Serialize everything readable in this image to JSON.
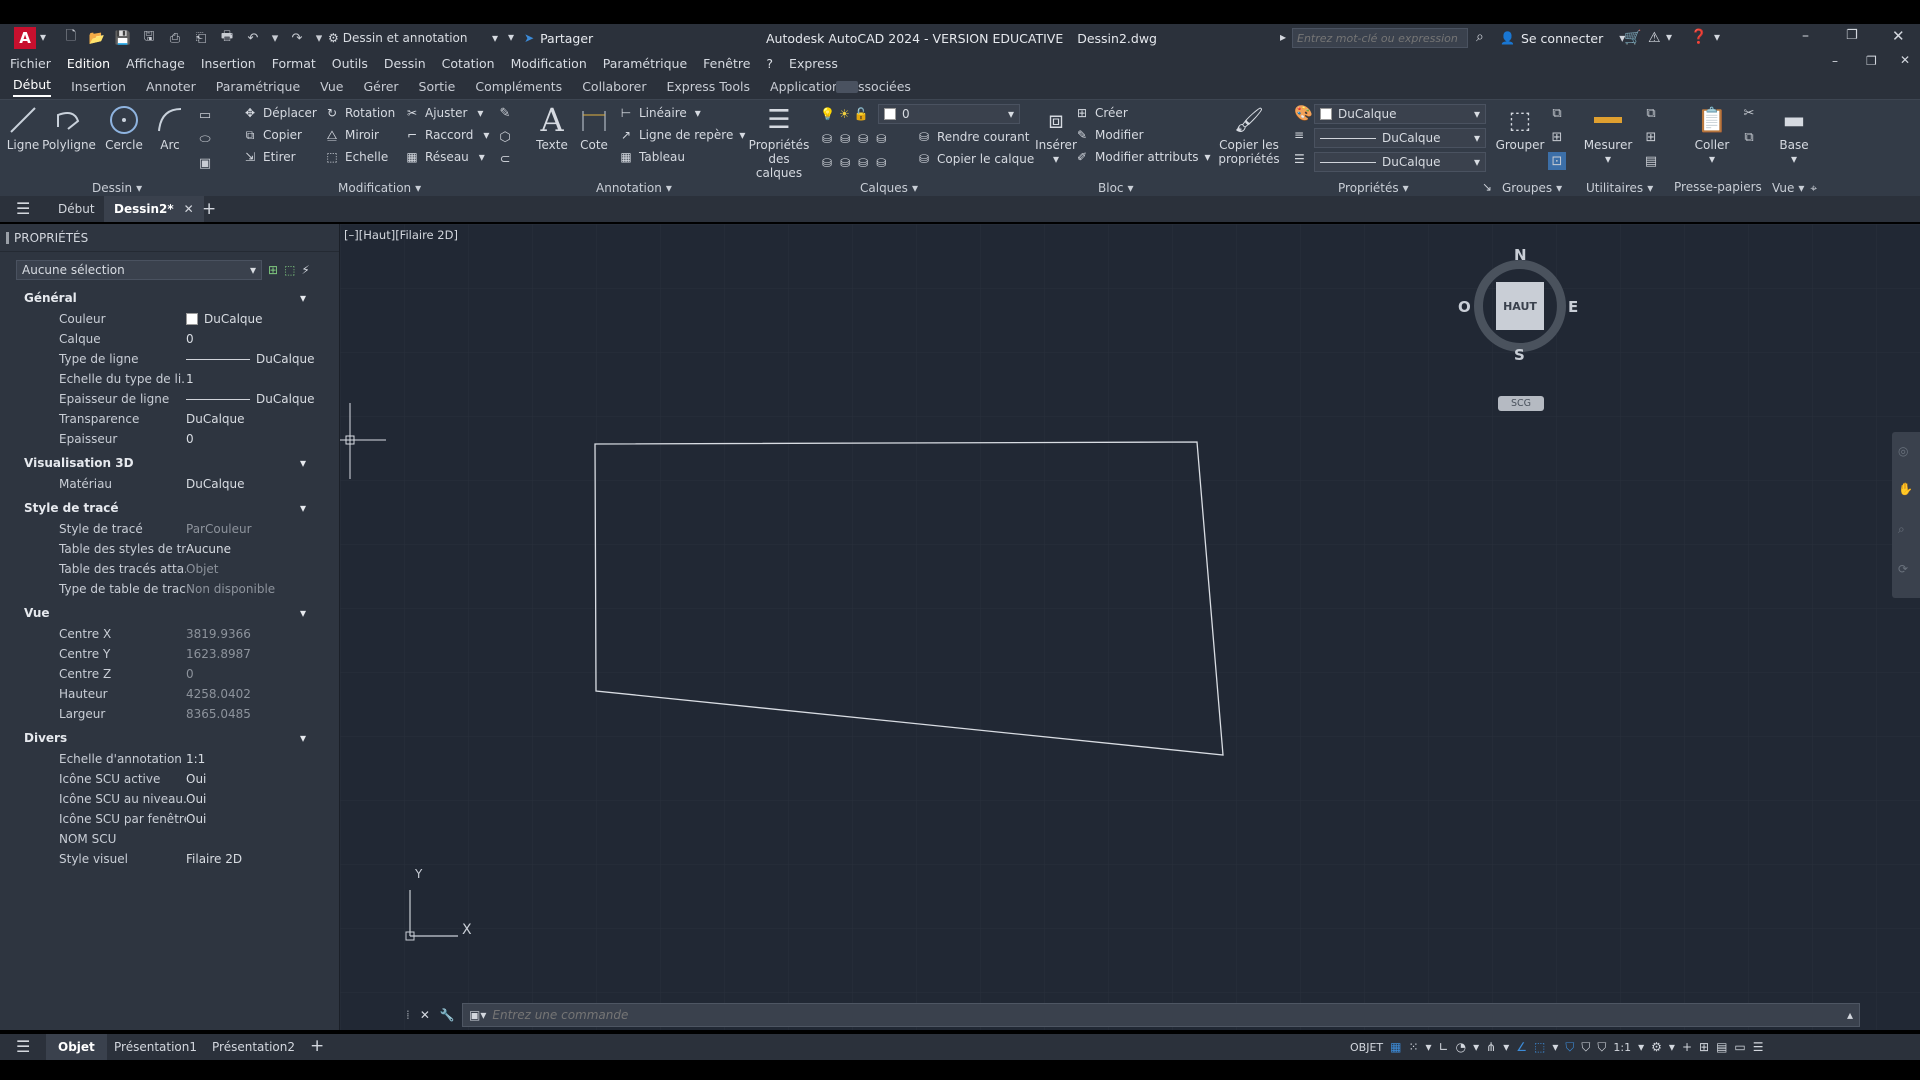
{
  "app": {
    "title": "Autodesk AutoCAD 2024 - VERSION EDUCATIVE",
    "file": "Dessin2.dwg",
    "logo": "A",
    "workspace": "Dessin et annotation",
    "share_label": "Partager",
    "search_placeholder": "Entrez mot-clé ou expression",
    "signin_label": "Se connecter"
  },
  "menu": [
    "Fichier",
    "Edition",
    "Affichage",
    "Insertion",
    "Format",
    "Outils",
    "Dessin",
    "Cotation",
    "Modification",
    "Paramétrique",
    "Fenêtre",
    "?",
    "Express"
  ],
  "ribbon_tabs": [
    "Début",
    "Insertion",
    "Annoter",
    "Paramétrique",
    "Vue",
    "Gérer",
    "Sortie",
    "Compléments",
    "Collaborer",
    "Express Tools",
    "Applications associées"
  ],
  "ribbon": {
    "dessin": {
      "label": "Dessin",
      "tools": [
        "Ligne",
        "Polyligne",
        "Cercle",
        "Arc"
      ]
    },
    "modification": {
      "label": "Modification",
      "col1": [
        "Déplacer",
        "Copier",
        "Etirer"
      ],
      "col2": [
        "Rotation",
        "Miroir",
        "Echelle"
      ],
      "col3": [
        "Ajuster",
        "Raccord",
        "Réseau"
      ]
    },
    "annotation": {
      "label": "Annotation",
      "big": [
        "Texte",
        "Cote"
      ],
      "small": [
        "Linéaire",
        "Ligne de repère",
        "Tableau"
      ]
    },
    "calques": {
      "label": "Calques",
      "big": "Propriétés des calques",
      "layer_value": "0",
      "small": [
        "Rendre courant",
        "Copier le calque"
      ]
    },
    "bloc": {
      "label": "Bloc",
      "big": "Insérer",
      "small": [
        "Créer",
        "Modifier",
        "Modifier attributs"
      ]
    },
    "proprietes": {
      "label": "Propriétés",
      "big": "Copier les propriétés",
      "values": [
        "DuCalque",
        "DuCalque",
        "DuCalque"
      ]
    },
    "groupes": {
      "label": "Groupes",
      "big": "Grouper"
    },
    "utilitaires": {
      "label": "Utilitaires",
      "big": "Mesurer"
    },
    "presse": {
      "label": "Presse-papiers",
      "big": "Coller"
    },
    "vue": {
      "label": "Vue",
      "big": "Base"
    }
  },
  "doc_tabs": [
    "Début",
    "Dessin2*"
  ],
  "properties": {
    "title": "PROPRIÉTÉS",
    "selection": "Aucune sélection",
    "sections": [
      {
        "name": "Général",
        "rows": [
          {
            "k": "Couleur",
            "v": "DuCalque",
            "swatch": true
          },
          {
            "k": "Calque",
            "v": "0"
          },
          {
            "k": "Type de ligne",
            "v": "DuCalque",
            "line": true
          },
          {
            "k": "Echelle du type de li...",
            "v": "1"
          },
          {
            "k": "Epaisseur de ligne",
            "v": "DuCalque",
            "line": true
          },
          {
            "k": "Transparence",
            "v": "DuCalque"
          },
          {
            "k": "Epaisseur",
            "v": "0"
          }
        ]
      },
      {
        "name": "Visualisation 3D",
        "rows": [
          {
            "k": "Matériau",
            "v": "DuCalque"
          }
        ]
      },
      {
        "name": "Style de tracé",
        "rows": [
          {
            "k": "Style de tracé",
            "v": "ParCouleur",
            "dim": true
          },
          {
            "k": "Table des styles de tr...",
            "v": "Aucune"
          },
          {
            "k": "Table des tracés atta...",
            "v": "Objet",
            "dim": true
          },
          {
            "k": "Type de table de tracé",
            "v": "Non disponible",
            "dim": true
          }
        ]
      },
      {
        "name": "Vue",
        "rows": [
          {
            "k": "Centre X",
            "v": "3819.9366",
            "dim": true
          },
          {
            "k": "Centre Y",
            "v": "1623.8987",
            "dim": true
          },
          {
            "k": "Centre Z",
            "v": "0",
            "dim": true
          },
          {
            "k": "Hauteur",
            "v": "4258.0402",
            "dim": true
          },
          {
            "k": "Largeur",
            "v": "8365.0485",
            "dim": true
          }
        ]
      },
      {
        "name": "Divers",
        "rows": [
          {
            "k": "Echelle d'annotation",
            "v": "1:1"
          },
          {
            "k": "Icône SCU active",
            "v": "Oui"
          },
          {
            "k": "Icône SCU au niveau...",
            "v": "Oui"
          },
          {
            "k": "Icône SCU par fenêtre",
            "v": "Oui"
          },
          {
            "k": "NOM SCU",
            "v": ""
          },
          {
            "k": "Style visuel",
            "v": "Filaire 2D"
          }
        ]
      }
    ]
  },
  "viewport": {
    "label": "[–][Haut][Filaire 2D]"
  },
  "viewcube": {
    "n": "N",
    "s": "S",
    "e": "E",
    "w": "O",
    "face": "HAUT",
    "wcs": "SCG"
  },
  "ucs": {
    "y": "Y",
    "x": "X"
  },
  "command": {
    "placeholder": "Entrez une commande"
  },
  "layout_tabs": [
    "Objet",
    "Présentation1",
    "Présentation2"
  ],
  "status": {
    "model": "OBJET",
    "scale": "1:1"
  },
  "colors": {
    "accent": "#3c8bd8",
    "canvas": "#212834",
    "panel": "#2e3540"
  }
}
